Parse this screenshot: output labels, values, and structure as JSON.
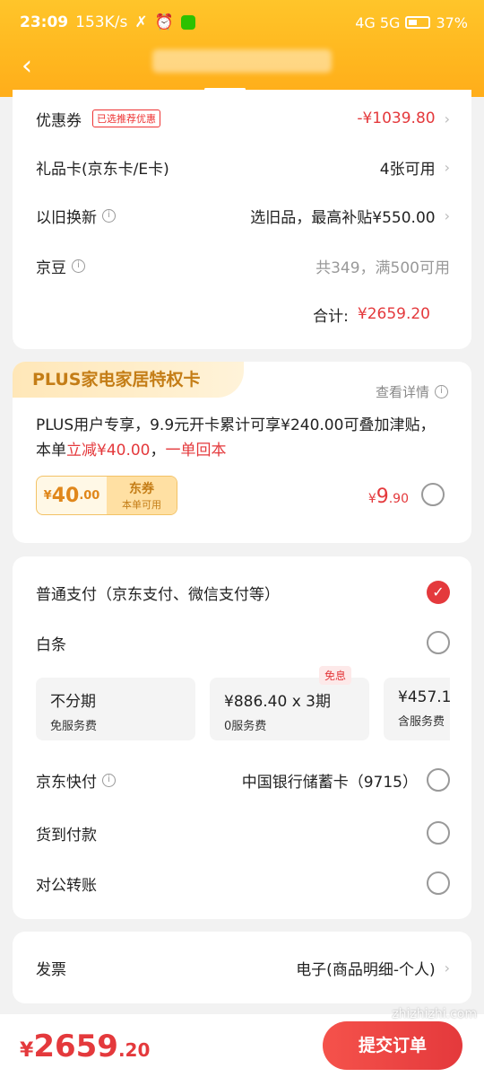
{
  "status_bar": {
    "time": "23:09",
    "speed": "153K/s",
    "battery": "37%",
    "network": "4G 5G"
  },
  "header": {
    "back": "‹"
  },
  "discounts": {
    "coupon_label": "优惠券",
    "coupon_tag": "已选推荐优惠",
    "coupon_value": "-¥1039.80",
    "giftcard_label": "礼品卡(京东卡/E卡)",
    "giftcard_value": "4张可用",
    "tradein_label": "以旧换新",
    "tradein_value": "选旧品，最高补贴¥550.00",
    "jingdou_label": "京豆",
    "jingdou_value": "共349，满500可用",
    "subtotal_label": "合计:",
    "subtotal_value": "¥2659.20"
  },
  "plus_card": {
    "title": "PLUS家电家居特权卡",
    "detail": "查看详情",
    "text_pre": "PLUS用户专享，9.9元开卡累计可享¥240.00可叠加津贴，本单",
    "text_red1": "立减¥40.00",
    "text_sep": "，",
    "text_red2": "一单回本",
    "coupon_amount": "40",
    "coupon_cents": ".00",
    "coupon_name": "东券",
    "coupon_sub": "本单可用",
    "price": "9",
    "price_cents": ".90",
    "currency": "¥"
  },
  "payment": {
    "normal_label": "普通支付（京东支付、微信支付等）",
    "baitiao_label": "白条",
    "installments": [
      {
        "title": "不分期",
        "sub": "免服务费"
      },
      {
        "title": "¥886.40 x 3期",
        "sub": "0服务费"
      },
      {
        "title": "¥457.1",
        "sub": "含服务费"
      }
    ],
    "free_badge": "免息",
    "quickpay_label": "京东快付",
    "quickpay_value": "中国银行储蓄卡（9715）",
    "cod_label": "货到付款",
    "transfer_label": "对公转账"
  },
  "invoice": {
    "label": "发票",
    "value": "电子(商品明细-个人)"
  },
  "footer": {
    "currency": "¥",
    "total_int": "2659",
    "total_cents": ".20",
    "submit": "提交订单"
  },
  "watermark": "zhizhizhi.com"
}
